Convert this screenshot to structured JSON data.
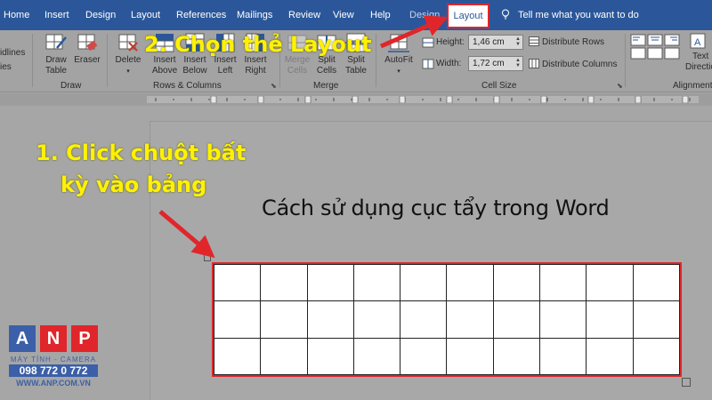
{
  "tabs": [
    "Home",
    "Insert",
    "Design",
    "Layout",
    "References",
    "Mailings",
    "Review",
    "View",
    "Help"
  ],
  "context_tabs": {
    "design": "Design",
    "layout": "Layout"
  },
  "tell_me": "Tell me what you want to do",
  "ribbon": {
    "left_cut": {
      "line1": "idlines",
      "line2": "ies"
    },
    "draw": {
      "draw_table_1": "Draw",
      "draw_table_2": "Table",
      "eraser": "Eraser",
      "label": "Draw"
    },
    "rows_columns": {
      "delete": "Delete",
      "insert_above_1": "Insert",
      "insert_above_2": "Above",
      "insert_below_1": "Insert",
      "insert_below_2": "Below",
      "insert_left_1": "Insert",
      "insert_left_2": "Left",
      "insert_right_1": "Insert",
      "insert_right_2": "Right",
      "label": "Rows & Columns"
    },
    "merge": {
      "merge_cells_1": "Merge",
      "merge_cells_2": "Cells",
      "split_cells_1": "Split",
      "split_cells_2": "Cells",
      "split_table_1": "Split",
      "split_table_2": "Table",
      "label": "Merge"
    },
    "cell_size": {
      "autofit": "AutoFit",
      "height_label": "Height:",
      "height_value": "1,46 cm",
      "width_label": "Width:",
      "width_value": "1,72 cm",
      "distribute_rows": "Distribute Rows",
      "distribute_columns": "Distribute Columns",
      "label": "Cell Size"
    },
    "alignment": {
      "text_direction_1": "Text",
      "text_direction_2": "Directio",
      "label": "Alignment"
    }
  },
  "document": {
    "title": "Cách sử dụng cục tẩy trong Word"
  },
  "table": {
    "rows": 3,
    "cols": 10
  },
  "annotations": {
    "step1_line1": "1. Click chuột bất",
    "step1_line2": "kỳ vào bảng",
    "step2": "2. Chọn thẻ Layout"
  },
  "logo": {
    "letters": [
      "A",
      "N",
      "P"
    ],
    "subtitle": "MÁY TÍNH - CAMERA",
    "phone": "098 772 0 772",
    "website": "WWW.ANP.COM.VN"
  },
  "colors": {
    "ribbon_blue": "#2b579a",
    "highlight_red": "#e0262b",
    "annotation_yellow": "#fff200"
  }
}
